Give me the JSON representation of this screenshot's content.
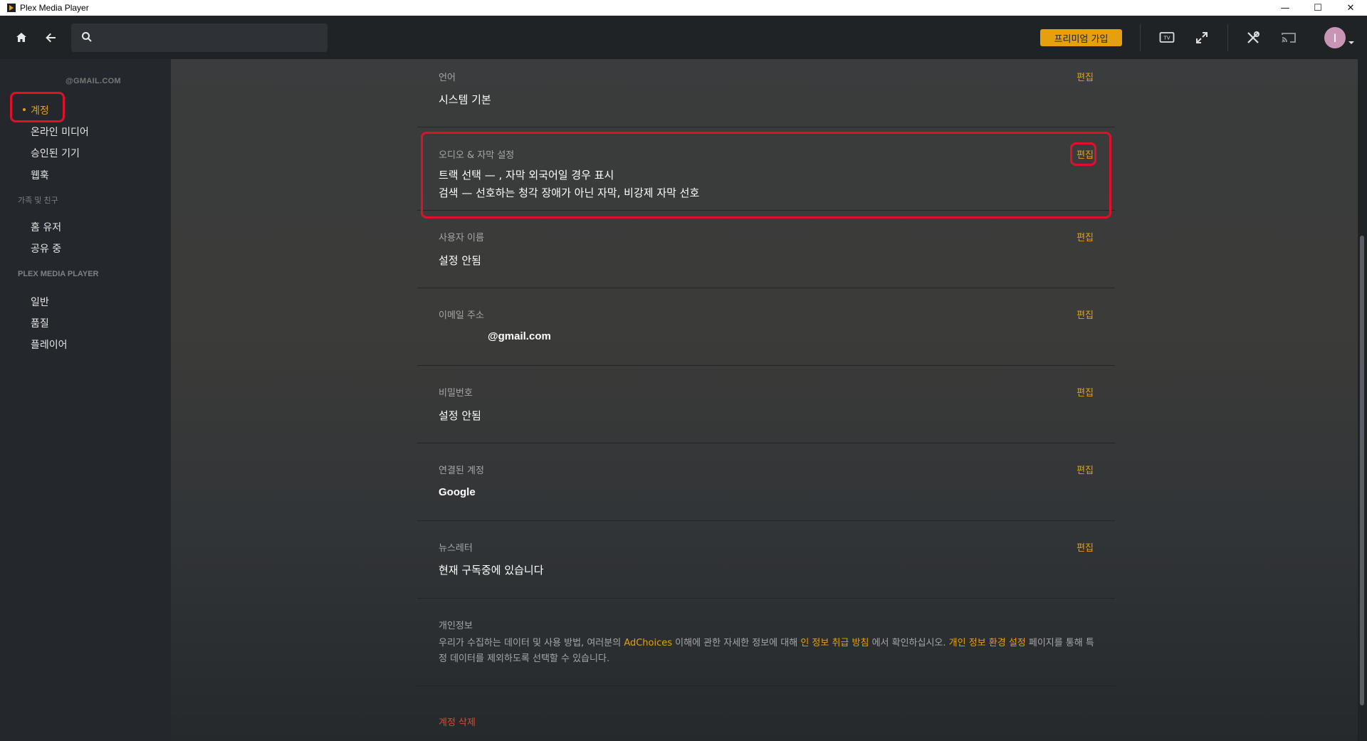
{
  "window": {
    "title": "Plex Media Player",
    "minimize": "—",
    "maximize": "☐",
    "close": "✕"
  },
  "topnav": {
    "search_placeholder": "",
    "premium_label": "프리미엄 가입",
    "avatar_letter": "I"
  },
  "sidebar": {
    "account_email": "@GMAIL.COM",
    "account_items": [
      "계정",
      "온라인 미디어",
      "승인된 기기",
      "웹훅"
    ],
    "family_section": "가족 및 친구",
    "family_items": [
      "홈 유저",
      "공유 중"
    ],
    "player_section": "PLEX MEDIA PLAYER",
    "player_items": [
      "일반",
      "품질",
      "플레이어"
    ]
  },
  "settings": {
    "edit_label": "편집",
    "language": {
      "label": "언어",
      "value": "시스템 기본"
    },
    "audio_subtitle": {
      "label": "오디오 & 자막 설정",
      "line1": "트랙 선택 — , 자막 외국어일 경우 표시",
      "line2": "검색 — 선호하는 청각 장애가 아닌 자막, 비강제 자막 선호"
    },
    "username": {
      "label": "사용자 이름",
      "value": "설정 안됨"
    },
    "email": {
      "label": "이메일 주소",
      "value": "@gmail.com"
    },
    "password": {
      "label": "비밀번호",
      "value": "설정 안됨"
    },
    "linked_accounts": {
      "label": "연결된 계정",
      "value": "Google"
    },
    "newsletter": {
      "label": "뉴스레터",
      "value": "현재 구독중에 있습니다"
    },
    "privacy": {
      "label": "개인정보",
      "text1": "우리가 수집하는 데이터 및 사용 방법, 여러분의 ",
      "link1": "AdChoices",
      "text2": " 이해에 관한 자세한 정보에 대해 ",
      "link2": "인 정보 취급 방침",
      "text3": " 에서 확인하십시오. ",
      "link3": "개인 정보 환경 설정",
      "text4": " 페이지를 통해 특정 데이터를 제외하도록 선택할 수 있습니다."
    },
    "delete_account": "계정 삭제"
  },
  "colors": {
    "accent": "#e5a00d",
    "highlight": "#e0102a",
    "danger": "#e5452a"
  }
}
